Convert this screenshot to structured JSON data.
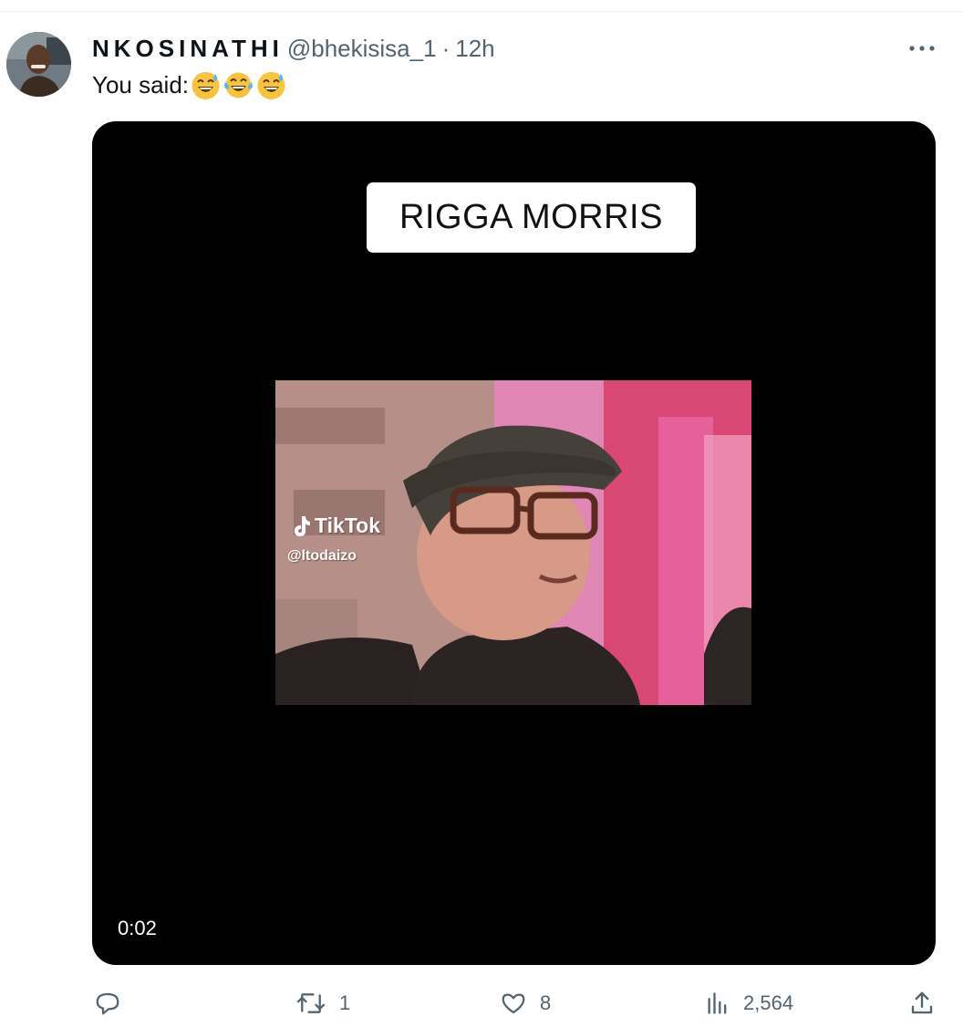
{
  "tweet": {
    "display_name": "NKOSINATHI",
    "handle": "@bhekisisa_1",
    "separator": "·",
    "time": "12h",
    "text": "You said:",
    "emojis": [
      "sweat-smile",
      "tears-of-joy",
      "sweat-smile"
    ]
  },
  "media": {
    "caption": "RIGGA MORRIS",
    "watermark_brand": "TikTok",
    "watermark_handle": "@ltodaizo",
    "duration": "0:02"
  },
  "actions": {
    "reply_count": "",
    "retweet_count": "1",
    "like_count": "8",
    "views_count": "2,564"
  },
  "colors": {
    "text_primary": "#0f1419",
    "text_secondary": "#536471",
    "media_background": "#000000"
  },
  "icons": [
    "more-icon",
    "reply-icon",
    "retweet-icon",
    "like-icon",
    "views-icon",
    "share-icon",
    "tiktok-icon"
  ]
}
